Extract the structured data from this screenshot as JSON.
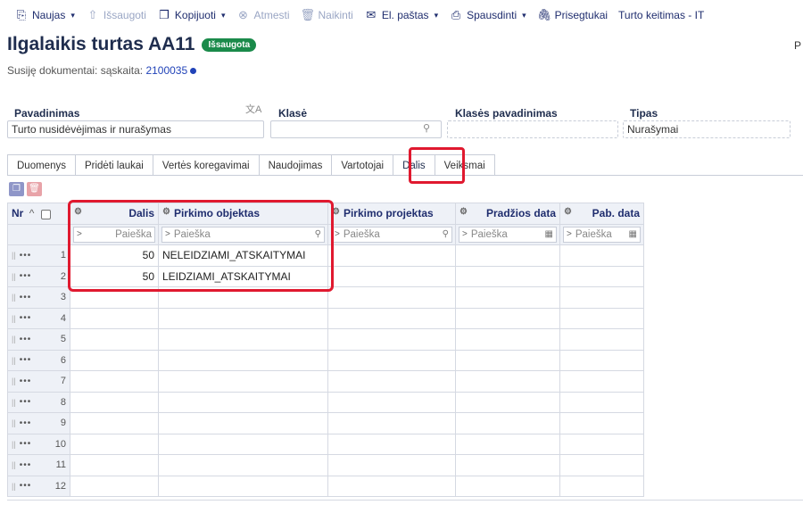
{
  "toolbar": [
    {
      "label": "Naujas",
      "icon": "new-doc-icon",
      "glyph": "⎘",
      "caret": true,
      "disabled": false
    },
    {
      "label": "Išsaugoti",
      "icon": "save-cloud-icon",
      "glyph": "⇧",
      "caret": false,
      "disabled": true
    },
    {
      "label": "Kopijuoti",
      "icon": "copy-icon",
      "glyph": "❐",
      "caret": true,
      "disabled": false
    },
    {
      "label": "Atmesti",
      "icon": "cancel-icon",
      "glyph": "⊗",
      "caret": false,
      "disabled": true
    },
    {
      "label": "Naikinti",
      "icon": "trash-icon",
      "glyph": "🗑",
      "caret": false,
      "disabled": true
    },
    {
      "label": "El. paštas",
      "icon": "mail-icon",
      "glyph": "✉",
      "caret": true,
      "disabled": false
    },
    {
      "label": "Spausdinti",
      "icon": "print-icon",
      "glyph": "⎙",
      "caret": true,
      "disabled": false
    },
    {
      "label": "Prisegtukai",
      "icon": "paperclip-icon",
      "glyph": "🖇",
      "caret": false,
      "disabled": false
    },
    {
      "label": "Turto keitimas - IT",
      "icon": "",
      "glyph": "",
      "caret": false,
      "disabled": false
    }
  ],
  "header": {
    "title": "Ilgalaikis turtas AA11",
    "badge": "Išsaugota",
    "edge_letter": "P",
    "related_label": "Susiję dokumentai: sąskaita:",
    "related_link": "2100035"
  },
  "fields": {
    "pavadinimas_label": "Pavadinimas",
    "pavadinimas_value": "Turto nusidėvėjimas ir nurašymas",
    "klase_label": "Klasė",
    "klase_value": "",
    "klases_pavadinimas_label": "Klasės pavadinimas",
    "klases_pavadinimas_value": "",
    "tipas_label": "Tipas",
    "tipas_value": "Nurašymai"
  },
  "tabs": [
    "Duomenys",
    "Pridėti laukai",
    "Vertės koregavimai",
    "Naudojimas",
    "Vartotojai",
    "Dalis",
    "Veiksmai"
  ],
  "active_tab": "Dalis",
  "grid": {
    "headers": {
      "nr": "Nr",
      "dalis": "Dalis",
      "pirkimo_objektas": "Pirkimo objektas",
      "pirkimo_projektas": "Pirkimo projektas",
      "pradzios_data": "Pradžios data",
      "pab_data": "Pab. data"
    },
    "filter_placeholder": "Paieška",
    "rows": [
      {
        "nr": "1",
        "dalis": "50",
        "pirkimo_objektas": "NELEIDZIAMI_ATSKAITYMAI"
      },
      {
        "nr": "2",
        "dalis": "50",
        "pirkimo_objektas": "LEIDZIAMI_ATSKAITYMAI"
      },
      {
        "nr": "3",
        "dalis": "",
        "pirkimo_objektas": ""
      },
      {
        "nr": "4",
        "dalis": "",
        "pirkimo_objektas": ""
      },
      {
        "nr": "5",
        "dalis": "",
        "pirkimo_objektas": ""
      },
      {
        "nr": "6",
        "dalis": "",
        "pirkimo_objektas": ""
      },
      {
        "nr": "7",
        "dalis": "",
        "pirkimo_objektas": ""
      },
      {
        "nr": "8",
        "dalis": "",
        "pirkimo_objektas": ""
      },
      {
        "nr": "9",
        "dalis": "",
        "pirkimo_objektas": ""
      },
      {
        "nr": "10",
        "dalis": "",
        "pirkimo_objektas": ""
      },
      {
        "nr": "11",
        "dalis": "",
        "pirkimo_objektas": ""
      },
      {
        "nr": "12",
        "dalis": "",
        "pirkimo_objektas": ""
      }
    ]
  },
  "colors": {
    "accent": "#1f2d6e",
    "badge": "#1a8a4a",
    "highlight": "#e0192f",
    "header_bg": "#eef1f7"
  }
}
